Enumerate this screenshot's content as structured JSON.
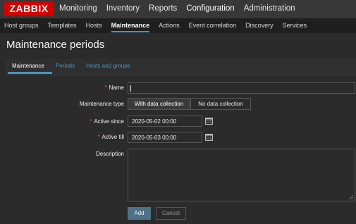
{
  "brand": {
    "logo_text": "ZABBIX",
    "color": "#d40000"
  },
  "top_nav": [
    "Monitoring",
    "Inventory",
    "Reports",
    "Configuration",
    "Administration"
  ],
  "top_nav_active": "Configuration",
  "sub_nav": [
    "Host groups",
    "Templates",
    "Hosts",
    "Maintenance",
    "Actions",
    "Event correlation",
    "Discovery",
    "Services"
  ],
  "sub_nav_active": "Maintenance",
  "page": {
    "title": "Maintenance periods"
  },
  "form_tabs": [
    "Maintenance",
    "Periods",
    "Hosts and groups"
  ],
  "form_tabs_active": "Maintenance",
  "form": {
    "name": {
      "label": "Name",
      "value": "",
      "required": true
    },
    "maintenance_type": {
      "label": "Maintenance type",
      "options": [
        "With data collection",
        "No data collection"
      ],
      "selected": "With data collection"
    },
    "active_since": {
      "label": "Active since",
      "value": "2020-05-02 00:00",
      "required": true
    },
    "active_till": {
      "label": "Active till",
      "value": "2020-05-03 00:00",
      "required": true
    },
    "description": {
      "label": "Description",
      "value": ""
    }
  },
  "buttons": {
    "add": "Add",
    "cancel": "Cancel"
  },
  "required_marker": "*",
  "colors": {
    "accent": "#4796c4",
    "required": "#e45959",
    "background": "#2b2b2b"
  }
}
